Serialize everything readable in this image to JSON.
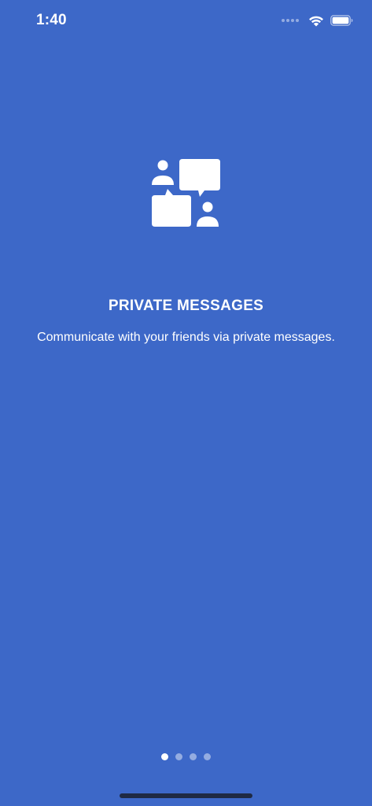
{
  "status_bar": {
    "time": "1:40",
    "wifi_icon": "wifi-icon",
    "battery_icon": "battery-icon",
    "signal_icon": "cellular-signal-icon"
  },
  "onboarding": {
    "icon": "chat-people-icon",
    "title": "PRIVATE MESSAGES",
    "description": "Communicate with your friends via private messages.",
    "pages_total": 4,
    "current_page": 1
  },
  "colors": {
    "background": "#3d68c8",
    "foreground": "#ffffff",
    "dot_inactive": "rgba(255,255,255,0.45)",
    "home_indicator": "#1f2a44"
  }
}
